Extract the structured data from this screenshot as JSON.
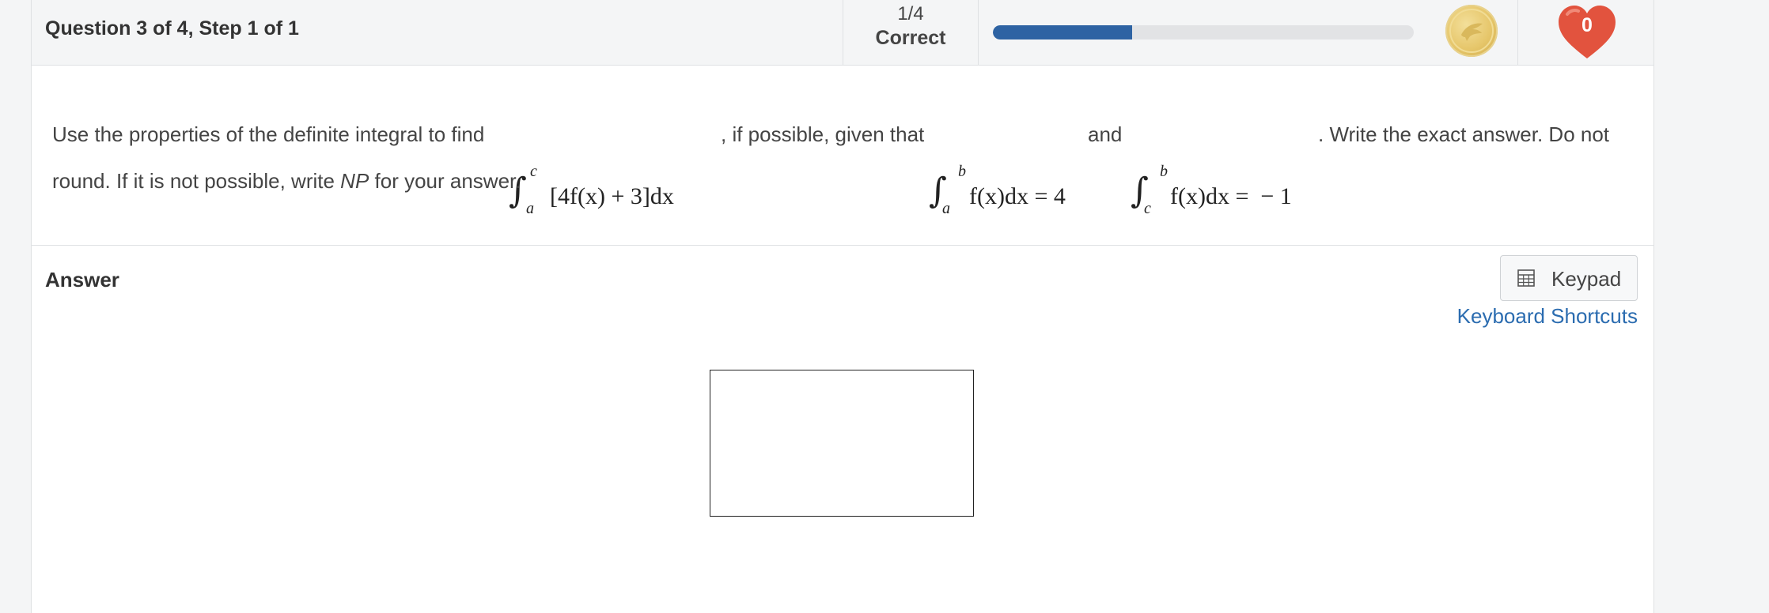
{
  "header": {
    "question_title": "Question 3 of 4, Step 1 of 1",
    "score_fraction": "1/4",
    "score_label": "Correct",
    "progress": 0.33,
    "hearts": "0",
    "coin_icon": "eagle-coin-icon",
    "heart_icon": "heart-icon"
  },
  "question": {
    "text_part1": "Use the properties of the definite integral to find",
    "integral1_upper": "c",
    "integral1_lower": "a",
    "integral1_integrand": "[4f(x) + 3]dx",
    "text_part2": ", if possible, given that",
    "integral2_upper": "b",
    "integral2_lower": "a",
    "integral2_expr": "f(x)dx = 4",
    "text_and": "and",
    "integral3_upper": "b",
    "integral3_lower": "c",
    "integral3_expr": "f(x)dx =  − 1",
    "text_part3": ". Write the exact answer. Do not",
    "line2_part1": "round. If it is not possible, write ",
    "line2_np": "NP",
    "line2_part2": " for your answer."
  },
  "answer": {
    "label": "Answer",
    "keypad_label": "Keypad",
    "keypad_icon": "calculator-icon",
    "shortcuts_label": "Keyboard Shortcuts",
    "input_value": ""
  },
  "colors": {
    "progress": "#2e63a3",
    "heart": "#e2533e",
    "link": "#2b6cb0"
  }
}
